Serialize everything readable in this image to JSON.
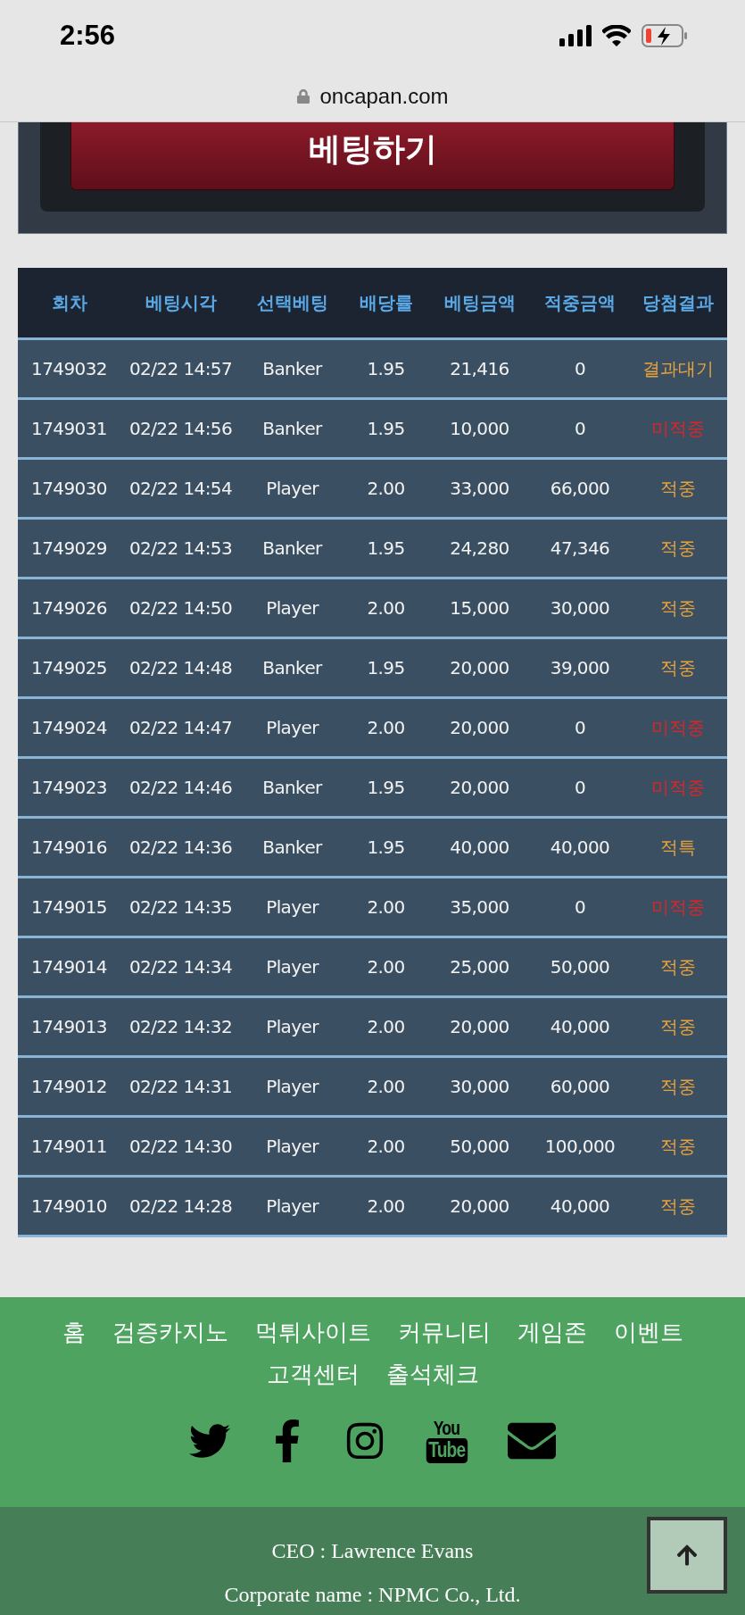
{
  "status_bar": {
    "time": "2:56"
  },
  "url_bar": {
    "url": "oncapan.com"
  },
  "bet_button": {
    "label": "베팅하기"
  },
  "table": {
    "columns": [
      "회차",
      "베팅시각",
      "선택베팅",
      "배당률",
      "베팅금액",
      "적중금액",
      "당첨결과"
    ],
    "rows": [
      {
        "cells": [
          "1749032",
          "02/22 14:57",
          "Banker",
          "1.95",
          "21,416",
          "0"
        ],
        "result": "결과대기",
        "color": "#e8a23a"
      },
      {
        "cells": [
          "1749031",
          "02/22 14:56",
          "Banker",
          "1.95",
          "10,000",
          "0"
        ],
        "result": "미적중",
        "color": "#e02424"
      },
      {
        "cells": [
          "1749030",
          "02/22 14:54",
          "Player",
          "2.00",
          "33,000",
          "66,000"
        ],
        "result": "적중",
        "color": "#e8a23a"
      },
      {
        "cells": [
          "1749029",
          "02/22 14:53",
          "Banker",
          "1.95",
          "24,280",
          "47,346"
        ],
        "result": "적중",
        "color": "#e8a23a"
      },
      {
        "cells": [
          "1749026",
          "02/22 14:50",
          "Player",
          "2.00",
          "15,000",
          "30,000"
        ],
        "result": "적중",
        "color": "#e8a23a"
      },
      {
        "cells": [
          "1749025",
          "02/22 14:48",
          "Banker",
          "1.95",
          "20,000",
          "39,000"
        ],
        "result": "적중",
        "color": "#e8a23a"
      },
      {
        "cells": [
          "1749024",
          "02/22 14:47",
          "Player",
          "2.00",
          "20,000",
          "0"
        ],
        "result": "미적중",
        "color": "#e02424"
      },
      {
        "cells": [
          "1749023",
          "02/22 14:46",
          "Banker",
          "1.95",
          "20,000",
          "0"
        ],
        "result": "미적중",
        "color": "#e02424"
      },
      {
        "cells": [
          "1749016",
          "02/22 14:36",
          "Banker",
          "1.95",
          "40,000",
          "40,000"
        ],
        "result": "적특",
        "color": "#e8a23a"
      },
      {
        "cells": [
          "1749015",
          "02/22 14:35",
          "Player",
          "2.00",
          "35,000",
          "0"
        ],
        "result": "미적중",
        "color": "#e02424"
      },
      {
        "cells": [
          "1749014",
          "02/22 14:34",
          "Player",
          "2.00",
          "25,000",
          "50,000"
        ],
        "result": "적중",
        "color": "#e8a23a"
      },
      {
        "cells": [
          "1749013",
          "02/22 14:32",
          "Player",
          "2.00",
          "20,000",
          "40,000"
        ],
        "result": "적중",
        "color": "#e8a23a"
      },
      {
        "cells": [
          "1749012",
          "02/22 14:31",
          "Player",
          "2.00",
          "30,000",
          "60,000"
        ],
        "result": "적중",
        "color": "#e8a23a"
      },
      {
        "cells": [
          "1749011",
          "02/22 14:30",
          "Player",
          "2.00",
          "50,000",
          "100,000"
        ],
        "result": "적중",
        "color": "#e8a23a"
      },
      {
        "cells": [
          "1749010",
          "02/22 14:28",
          "Player",
          "2.00",
          "20,000",
          "40,000"
        ],
        "result": "적중",
        "color": "#e8a23a"
      }
    ]
  },
  "footer": {
    "nav": [
      "홈",
      "검증카지노",
      "먹튀사이트",
      "커뮤니티",
      "게임존",
      "이벤트",
      "고객센터",
      "출석체크"
    ],
    "social": [
      {
        "kind": "twitter"
      },
      {
        "kind": "facebook"
      },
      {
        "kind": "instagram"
      },
      {
        "kind": "youtube",
        "text": [
          "You",
          "Tube"
        ]
      },
      {
        "kind": "mail"
      }
    ],
    "ceo": "CEO : Lawrence Evans",
    "company": "Corporate name : NPMC Co., Ltd."
  }
}
